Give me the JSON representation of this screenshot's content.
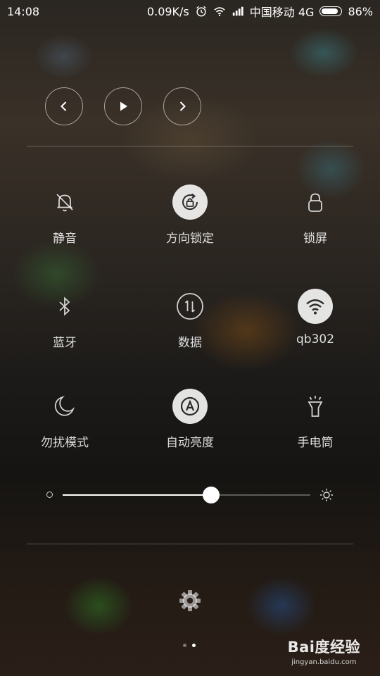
{
  "status_bar": {
    "time": "14:08",
    "net_speed": "0.09K/s",
    "carrier": "中国移动 4G",
    "battery_percent": "86%",
    "battery_level": 0.86,
    "icons": [
      "alarm-icon",
      "wifi-icon",
      "signal-icon",
      "battery-icon"
    ]
  },
  "media": {
    "buttons": [
      "previous-icon",
      "play-icon",
      "next-icon"
    ]
  },
  "toggles": [
    {
      "label": "静音",
      "icon": "bell-off-icon",
      "active": false
    },
    {
      "label": "方向锁定",
      "icon": "rotation-lock-icon",
      "active": true
    },
    {
      "label": "锁屏",
      "icon": "lock-icon",
      "active": false
    },
    {
      "label": "蓝牙",
      "icon": "bluetooth-icon",
      "active": false
    },
    {
      "label": "数据",
      "icon": "data-arrows-icon",
      "active": false
    },
    {
      "label": "qb302",
      "icon": "wifi-icon",
      "active": true
    },
    {
      "label": "勿扰模式",
      "icon": "moon-icon",
      "active": false
    },
    {
      "label": "自动亮度",
      "icon": "auto-brightness-icon",
      "active": true
    },
    {
      "label": "手电筒",
      "icon": "flashlight-icon",
      "active": false
    }
  ],
  "brightness": {
    "level": 0.6,
    "low_icon": "brightness-low-icon",
    "high_icon": "brightness-high-icon"
  },
  "settings": {
    "icon": "gear-icon"
  },
  "pages": {
    "count": 2,
    "current": 2
  },
  "watermark": {
    "logo": "Bai度经验",
    "url": "jingyan.baidu.com"
  },
  "colors": {
    "active_bg": "#e6e6e6",
    "active_icon": "#2a2a2a",
    "text": "#ffffff"
  }
}
